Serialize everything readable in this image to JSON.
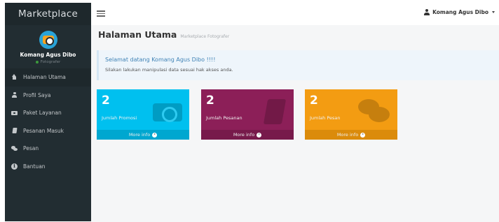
{
  "brand": "Marketplace",
  "profile": {
    "name": "Komang Agus Dibo",
    "role": "Fotografer"
  },
  "sidebar": {
    "items": [
      {
        "label": "Halaman Utama",
        "icon": "home-icon"
      },
      {
        "label": "Profil Saya",
        "icon": "user-icon"
      },
      {
        "label": "Paket Layanan",
        "icon": "camera-icon"
      },
      {
        "label": "Pesanan Masuk",
        "icon": "book-icon"
      },
      {
        "label": "Pesan",
        "icon": "chat-icon"
      },
      {
        "label": "Bantuan",
        "icon": "info-icon"
      }
    ]
  },
  "topbar": {
    "user_name": "Komang Agus Dibo"
  },
  "header": {
    "title": "Halaman Utama",
    "subtitle": "Marketplace Fotografer"
  },
  "callout": {
    "title": "Selamat datang Komang Agus Dibo !!!!",
    "text": "Silakan lakukan manipulasi data sesuai hak akses anda."
  },
  "boxes": [
    {
      "count": "2",
      "label": "Jumlah Promosi",
      "footer": "More info",
      "color": "#00c0ef",
      "icon": "camera-icon"
    },
    {
      "count": "2",
      "label": "Jumlah Pesanan",
      "footer": "More info",
      "color": "#8c1f58",
      "icon": "book-icon"
    },
    {
      "count": "2",
      "label": "Jumlah Pesan",
      "footer": "More info",
      "color": "#f39c12",
      "icon": "chat-icon"
    }
  ],
  "colors": {
    "sidebar_bg": "#222d32",
    "callout_title": "#3f82b5"
  }
}
